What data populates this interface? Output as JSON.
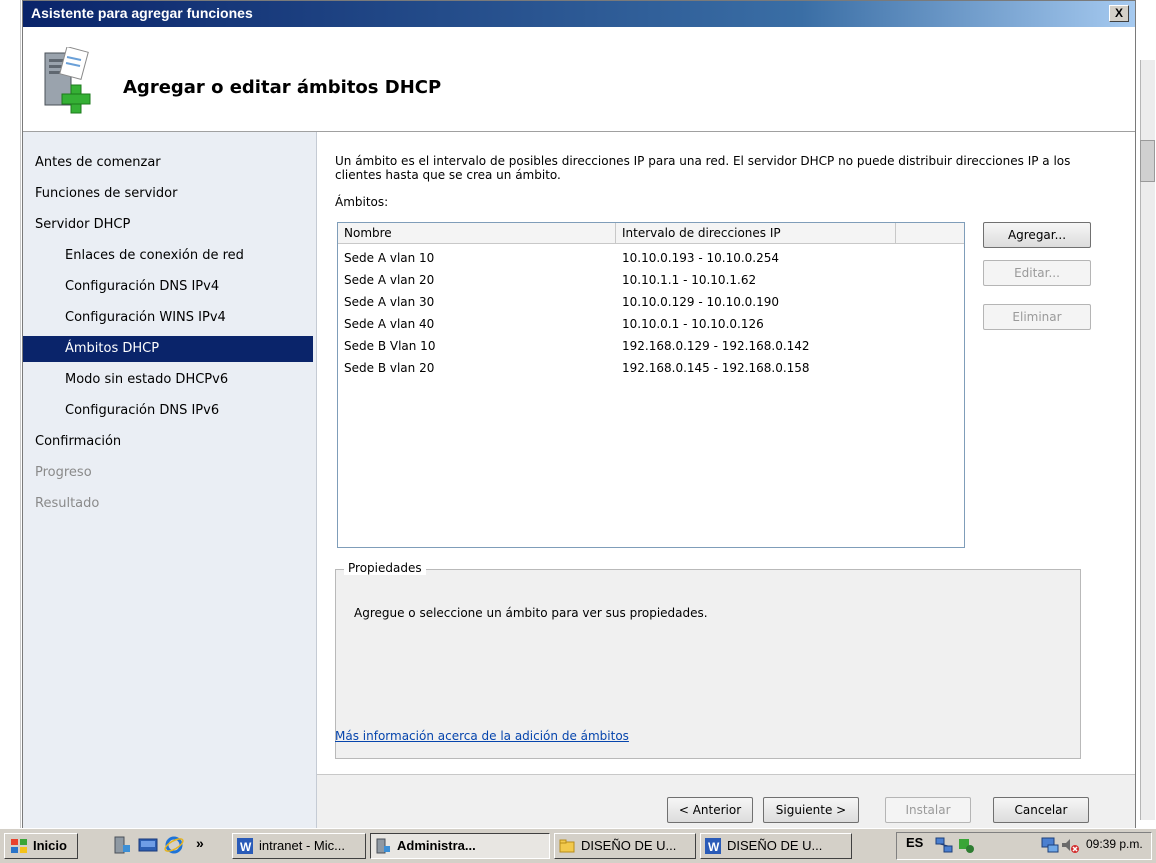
{
  "window": {
    "title": "Asistente para agregar funciones",
    "close_label": "X"
  },
  "header": {
    "title": "Agregar o editar ámbitos DHCP",
    "icon": "server-add-icon"
  },
  "nav": {
    "items": [
      {
        "label": "Antes de comenzar",
        "state": "normal"
      },
      {
        "label": "Funciones de servidor",
        "state": "normal"
      },
      {
        "label": "Servidor DHCP",
        "state": "normal"
      },
      {
        "label": "Enlaces de conexión de red",
        "state": "sub"
      },
      {
        "label": "Configuración DNS IPv4",
        "state": "sub"
      },
      {
        "label": "Configuración WINS IPv4",
        "state": "sub"
      },
      {
        "label": "Ámbitos DHCP",
        "state": "selected"
      },
      {
        "label": "Modo sin estado DHCPv6",
        "state": "sub"
      },
      {
        "label": "Configuración DNS IPv6",
        "state": "sub"
      },
      {
        "label": "Confirmación",
        "state": "normal"
      },
      {
        "label": "Progreso",
        "state": "disabled"
      },
      {
        "label": "Resultado",
        "state": "disabled"
      }
    ]
  },
  "content": {
    "intro": "Un ámbito es el intervalo de posibles direcciones IP para una red. El servidor DHCP no puede distribuir direcciones IP a los clientes hasta que se crea un ámbito.",
    "scopes_label": "Ámbitos:",
    "columns": [
      "Nombre",
      "Intervalo de direcciones IP"
    ],
    "rows": [
      {
        "name": "Sede A vlan 10",
        "range": "10.10.0.193 - 10.10.0.254"
      },
      {
        "name": "Sede A vlan 20",
        "range": "10.10.1.1 - 10.10.1.62"
      },
      {
        "name": "Sede A vlan 30",
        "range": "10.10.0.129 - 10.10.0.190"
      },
      {
        "name": "Sede A vlan 40",
        "range": "10.10.0.1 - 10.10.0.126"
      },
      {
        "name": "Sede B Vlan 10",
        "range": "192.168.0.129 - 192.168.0.142"
      },
      {
        "name": "Sede B vlan 20",
        "range": "192.168.0.145 - 192.168.0.158"
      }
    ],
    "buttons": {
      "add": "Agregar...",
      "edit": "Editar...",
      "delete": "Eliminar"
    },
    "properties_legend": "Propiedades",
    "properties_text": "Agregue o seleccione un ámbito para ver sus propiedades.",
    "more_info_link": "Más información acerca de la adición de ámbitos"
  },
  "footer": {
    "prev": "< Anterior",
    "next": "Siguiente >",
    "install": "Instalar",
    "cancel": "Cancelar"
  },
  "taskbar": {
    "start": "Inicio",
    "items": [
      {
        "label": "intranet - Mic...",
        "icon": "word-icon"
      },
      {
        "label": "Administra...",
        "icon": "server-manager-icon",
        "active": true
      },
      {
        "label": "DISEÑO DE U...",
        "icon": "folder-icon"
      },
      {
        "label": "DISEÑO DE U...",
        "icon": "word-icon"
      }
    ],
    "language": "ES",
    "clock": "09:39 p.m."
  },
  "colors": {
    "title_bar": "#0a246a",
    "nav_selected": "#0a246a",
    "link": "#0645ad",
    "nav_bg": "#eaeef4"
  }
}
